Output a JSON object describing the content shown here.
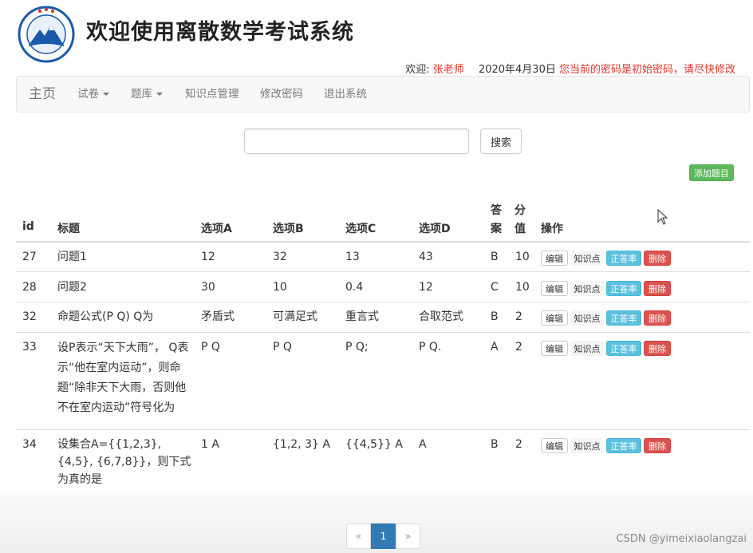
{
  "header": {
    "title": "欢迎使用离散数学考试系统",
    "welcome_label": "欢迎:",
    "user_name": "张老师",
    "date": "2020年4月30日",
    "password_warning": "您当前的密码是初始密码，请尽快修改"
  },
  "nav": {
    "home": "主页",
    "papers": "试卷",
    "question_bank": "题库",
    "knowledge": "知识点管理",
    "change_password": "修改密码",
    "logout": "退出系统"
  },
  "search": {
    "placeholder": "",
    "button": "搜索"
  },
  "add_button": "添加题目",
  "table": {
    "headers": {
      "id": "id",
      "title": "标题",
      "a": "选项A",
      "b": "选项B",
      "c": "选项C",
      "d": "选项D",
      "answer": "答案",
      "score": "分值",
      "ops": "操作"
    },
    "op_labels": {
      "edit": "编辑",
      "knowledge": "知识点",
      "rate": "正答率",
      "delete": "删除"
    },
    "rows": [
      {
        "id": "27",
        "title": "问题1",
        "a": "12",
        "b": "32",
        "c": "13",
        "d": "43",
        "answer": "B",
        "score": "10"
      },
      {
        "id": "28",
        "title": "问题2",
        "a": "30",
        "b": "10",
        "c": "0.4",
        "d": "12",
        "answer": "C",
        "score": "10"
      },
      {
        "id": "32",
        "title": "命题公式(P Q) Q为",
        "a": "矛盾式",
        "b": "可满足式",
        "c": "重言式",
        "d": "合取范式",
        "answer": "B",
        "score": "2"
      },
      {
        "id": "33",
        "title": "设P表示“天下大雨”， Q表示“他在室内运动”，则命题“除非天下大雨，否则他不在室内运动”符号化为",
        "a": "P Q",
        "b": "P Q",
        "c": "P Q;",
        "d": "P Q.",
        "answer": "A",
        "score": "2"
      },
      {
        "id": "34",
        "title": "设集合A={{1,2,3}, {4,5}, {6,7,8}}，则下式为真的是",
        "a": "1 A",
        "b": "{1,2, 3} A",
        "c": "{{4,5}} A",
        "d": "A",
        "answer": "B",
        "score": "2"
      }
    ]
  },
  "pagination": {
    "prev": "«",
    "current": "1",
    "next": "»"
  },
  "watermark": "CSDN @yimeixiaolangzai",
  "colors": {
    "accent": "#337ab7",
    "danger": "#d9534f",
    "info": "#5bc0de",
    "success": "#5cb85c",
    "warning_text": "#e0352b"
  },
  "icons": {
    "logo": "university-seal-logo",
    "cursor": "mouse-pointer-icon"
  }
}
